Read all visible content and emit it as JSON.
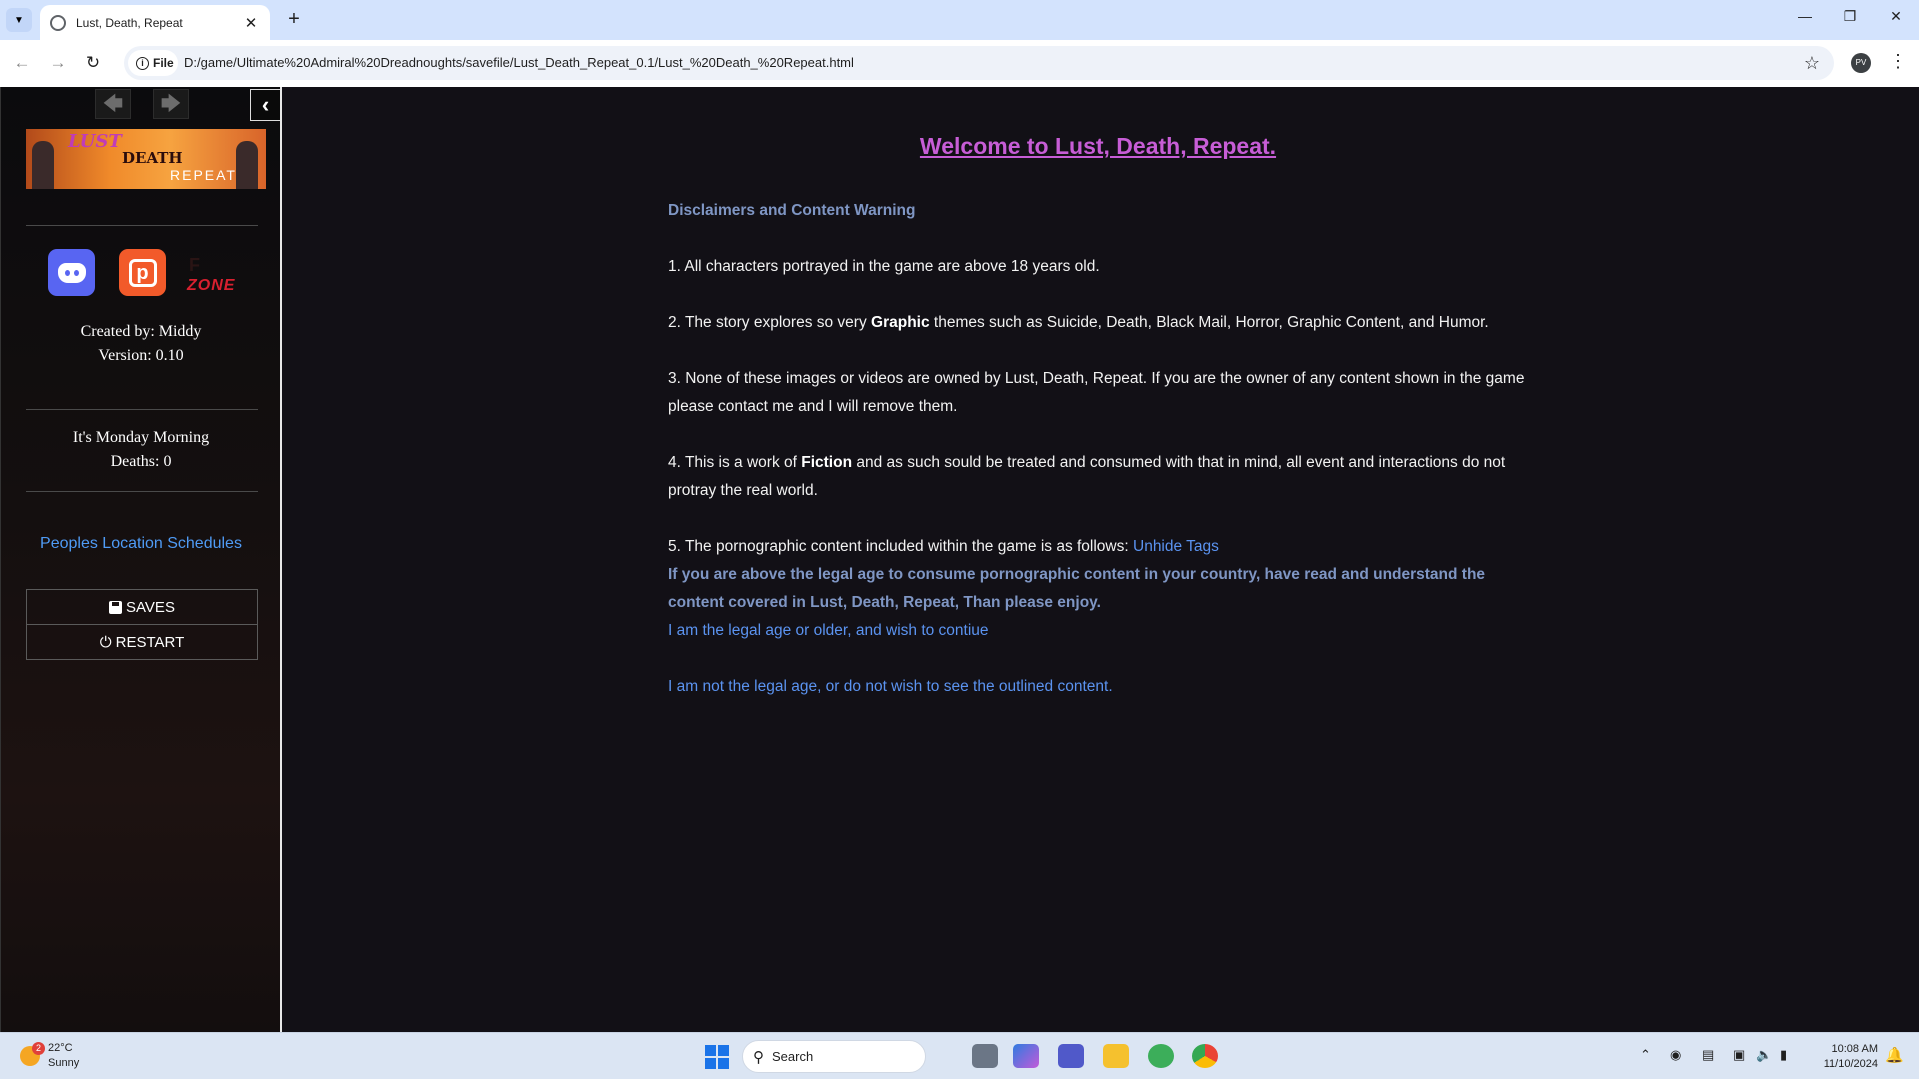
{
  "browser": {
    "tab_title": "Lust, Death, Repeat",
    "chip_label": "File",
    "url": "D:/game/Ultimate%20Admiral%20Dreadnoughts/savefile/Lust_Death_Repeat_0.1/Lust_%20Death_%20Repeat.html",
    "profile_initials": "PV"
  },
  "sidebar": {
    "banner": {
      "line1": "LUST",
      "line2": "DEATH",
      "line3": "REPEAT"
    },
    "fzone_label": "ZONE",
    "created_by": "Created by: Middy",
    "version": "Version: 0.10",
    "time_of_day": "It's Monday Morning",
    "deaths": "Deaths: 0",
    "schedules_link": "Peoples Location Schedules",
    "saves_label": "SAVES",
    "restart_label": "RESTART"
  },
  "main": {
    "title": "Welcome to Lust, Death, Repeat.",
    "disclaimer_heading": "Disclaimers and Content Warning",
    "item1": "1. All characters portrayed in the game are above 18 years old.",
    "item2_pre": "2. The story explores so very ",
    "item2_bold": "Graphic",
    "item2_post": " themes such as Suicide, Death, Black Mail, Horror, Graphic Content, and Humor.",
    "item3": "3. None of these images or videos are owned by Lust, Death, Repeat. If you are the owner of any content shown in the game please contact me and I will remove them.",
    "item4_pre": "4. This is a work of ",
    "item4_bold": "Fiction",
    "item4_post": " and as such sould be treated and consumed with that in mind, all event and interactions do not protray the real world.",
    "item5_pre": "5. The pornographic content included within the game is as follows: ",
    "item5_link": "Unhide Tags",
    "age_notice": "If you are above the legal age to consume pornographic content in your country, have read and understand the content covered in Lust, Death, Repeat, Than please enjoy.",
    "accept_link": "I am the legal age or older, and wish to contiue",
    "decline_link": "I am not the legal age, or do not wish to see the outlined content."
  },
  "taskbar": {
    "weather_temp": "22°C",
    "weather_desc": "Sunny",
    "weather_badge": "2",
    "search_placeholder": "Search",
    "time": "10:08 AM",
    "date": "11/10/2024"
  },
  "colors": {
    "title": "#c75dd6",
    "accent": "#7f96c4",
    "link": "#5b93f0",
    "background": "#121016"
  }
}
